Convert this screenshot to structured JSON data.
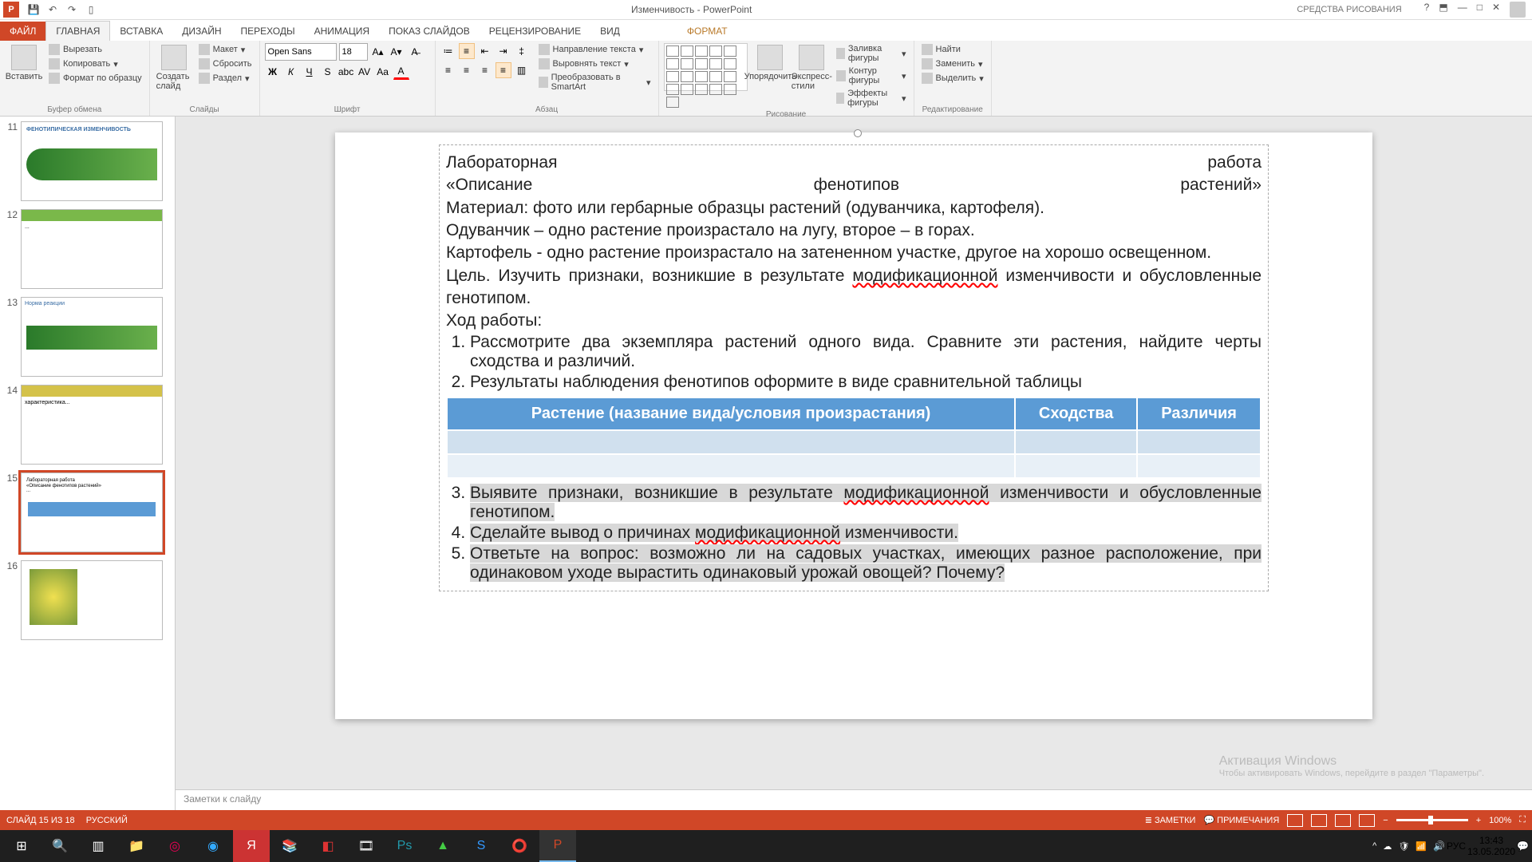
{
  "titlebar": {
    "doc_title": "Изменчивость - PowerPoint",
    "tools_title": "СРЕДСТВА РИСОВАНИЯ"
  },
  "tabs": {
    "file": "ФАЙЛ",
    "home": "ГЛАВНАЯ",
    "insert": "ВСТАВКА",
    "design": "ДИЗАЙН",
    "transitions": "ПЕРЕХОДЫ",
    "animations": "АНИМАЦИЯ",
    "slideshow": "ПОКАЗ СЛАЙДОВ",
    "review": "РЕЦЕНЗИРОВАНИЕ",
    "view": "ВИД",
    "format": "ФОРМАТ"
  },
  "ribbon": {
    "paste": "Вставить",
    "cut": "Вырезать",
    "copy": "Копировать",
    "format_painter": "Формат по образцу",
    "clipboard": "Буфер обмена",
    "new_slide": "Создать слайд",
    "layout": "Макет",
    "reset": "Сбросить",
    "section": "Раздел",
    "slides": "Слайды",
    "font_name": "Open Sans",
    "font_size": "18",
    "font": "Шрифт",
    "paragraph": "Абзац",
    "text_direction": "Направление текста",
    "align_text": "Выровнять текст",
    "smartart": "Преобразовать в SmartArt",
    "arrange": "Упорядочить",
    "quick_styles": "Экспресс-стили",
    "shape_fill": "Заливка фигуры",
    "shape_outline": "Контур фигуры",
    "shape_effects": "Эффекты фигуры",
    "drawing": "Рисование",
    "find": "Найти",
    "replace": "Заменить",
    "select": "Выделить",
    "editing": "Редактирование"
  },
  "thumbs": {
    "n11": "11",
    "n12": "12",
    "n13": "13",
    "n14": "14",
    "n15": "15",
    "n16": "16"
  },
  "slide": {
    "l1a": "Лабораторная",
    "l1b": "работа",
    "l2a": "«Описание",
    "l2b": "фенотипов",
    "l2c": "растений»",
    "l3": "Материал: фото или гербарные образцы растений (одуванчика, картофеля).",
    "l4": "Одуванчик – одно растение произрастало на лугу, второе – в горах.",
    "l5": "Картофель -  одно растение произрастало на затененном участке, другое на хорошо освещенном.",
    "l6a": "Цель. Изучить признаки, возникшие в результате ",
    "l6b": "модификационной",
    "l6c": " изменчивости и обусловленные генотипом.",
    "l7": "Ход работы:",
    "li1": "Рассмотрите два экземпляра растений одного вида. Сравните эти растения, найдите черты сходства и различий.",
    "li2": "Результаты наблюдения фенотипов оформите в виде сравнительной таблицы",
    "th1": "Растение (название вида/условия произрастания)",
    "th2": "Сходства",
    "th3": "Различия",
    "li3a": "Выявите признаки, возникшие в результате ",
    "li3b": "модификационной",
    "li3c": " изменчивости и обусловленные генотипом.",
    "li4a": "Сделайте вывод о причинах ",
    "li4b": "модификационной",
    "li4c": " изменчивости.",
    "li5": "Ответьте на вопрос: возможно ли на садовых участках, имеющих разное расположение, при одинаковом уходе вырастить одинаковый урожай овощей? Почему?"
  },
  "notes": {
    "placeholder": "Заметки к слайду"
  },
  "watermark": {
    "l1": "Активация Windows",
    "l2": "Чтобы активировать Windows, перейдите в раздел \"Параметры\"."
  },
  "status": {
    "slide_info": "СЛАЙД 15 ИЗ 18",
    "lang": "РУССКИЙ",
    "notes": "ЗАМЕТКИ",
    "comments": "ПРИМЕЧАНИЯ",
    "zoom": "100%"
  },
  "taskbar": {
    "lang": "РУС",
    "time": "13:43",
    "date": "13.05.2020"
  }
}
